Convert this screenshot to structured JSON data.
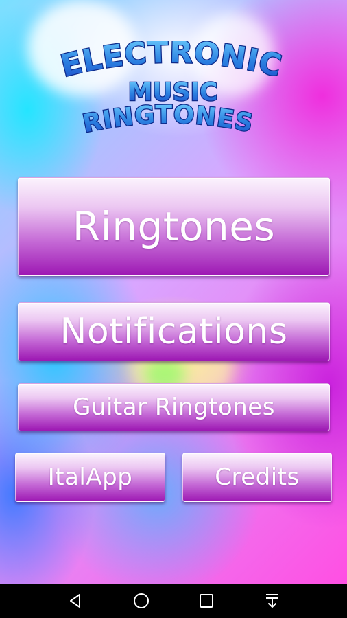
{
  "logo": {
    "line1": "ELECTRONIC",
    "line2": "MUSIC",
    "line3": "RINGTONES"
  },
  "menu": {
    "ringtones": "Ringtones",
    "notifications": "Notifications",
    "guitar_ringtones": "Guitar Ringtones",
    "italapp": "ItalApp",
    "credits": "Credits"
  },
  "navbar": {
    "icons": [
      "back-icon",
      "home-icon",
      "recents-icon",
      "download-icon"
    ]
  },
  "colors": {
    "button_top": "#fbf3fd",
    "button_bottom": "#9d18b3",
    "logo_fill": "#2f8fe6",
    "logo_stroke": "#0d2a8a",
    "navbar": "#000000"
  }
}
